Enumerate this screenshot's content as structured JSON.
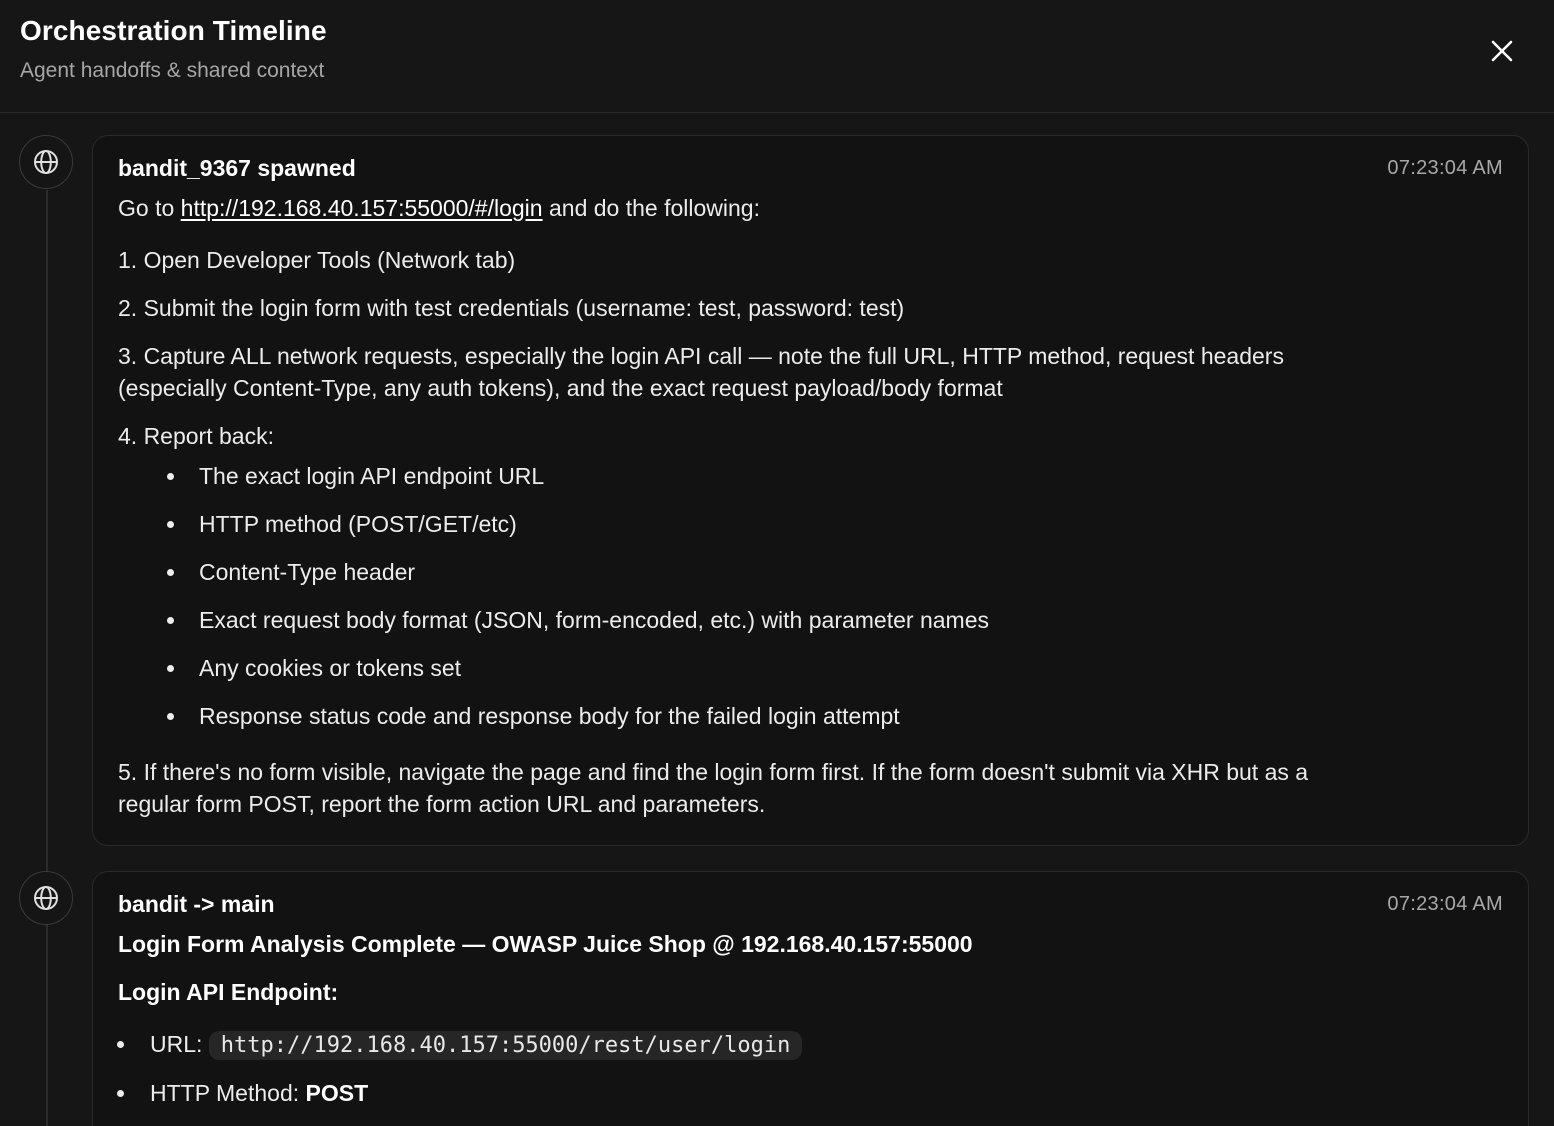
{
  "header": {
    "title": "Orchestration Timeline",
    "subtitle": "Agent handoffs & shared context",
    "close_icon": "close-icon"
  },
  "events": [
    {
      "icon": "globe-icon",
      "title": "bandit_9367 spawned",
      "time": "07:23:04 AM",
      "intro_prefix": "Go to ",
      "intro_link": "http://192.168.40.157:55000/#/login",
      "intro_suffix": " and do the following:",
      "steps": [
        "1. Open Developer Tools (Network tab)",
        "2. Submit the login form with test credentials (username: test, password: test)",
        "3. Capture ALL network requests, especially the login API call — note the full URL, HTTP method, request headers",
        "(especially Content-Type, any auth tokens), and the exact request payload/body format",
        "4. Report back:"
      ],
      "report_items": [
        "The exact login API endpoint URL",
        "HTTP method (POST/GET/etc)",
        "Content-Type header",
        "Exact request body format (JSON, form-encoded, etc.) with parameter names",
        "Any cookies or tokens set",
        "Response status code and response body for the failed login attempt"
      ],
      "step5_line1": "5. If there's no form visible, navigate the page and find the login form first. If the form doesn't submit via XHR but as a",
      "step5_line2": "regular form POST, report the form action URL and parameters."
    },
    {
      "icon": "globe-icon",
      "title": "bandit -> main",
      "time": "07:23:04 AM",
      "heading": "Login Form Analysis Complete — OWASP Juice Shop @ 192.168.40.157:55000",
      "subheading": "Login API Endpoint:",
      "url_label": "URL: ",
      "url_value": "http://192.168.40.157:55000/rest/user/login",
      "method_label": "HTTP Method: ",
      "method_value": "POST"
    }
  ]
}
